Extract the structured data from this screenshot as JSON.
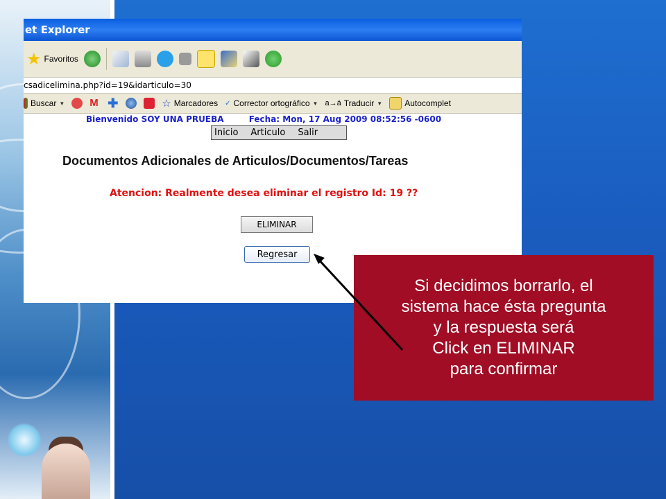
{
  "browser": {
    "title": "et Explorer",
    "toolbar": {
      "favorites_label": "Favoritos"
    },
    "address": "csadicelimina.php?id=19&idarticulo=30",
    "links": {
      "buscar": "Buscar",
      "marcadores": "Marcadores",
      "corrector": "Corrector ortográfico",
      "traducir": "Traducir",
      "autocompletar": "Autocomplet"
    }
  },
  "page": {
    "welcome": "Bienvenido SOY UNA PRUEBA",
    "fecha": "Fecha:   Mon, 17 Aug 2009 08:52:56 -0600",
    "menu": [
      "Inicio",
      "Articulo",
      "Salir"
    ],
    "title": "Documentos Adicionales de Articulos/Documentos/Tareas",
    "warning": "Atencion: Realmente desea eliminar el registro Id: 19 ??",
    "eliminar_label": "ELIMINAR",
    "regresar_label": "Regresar"
  },
  "callout": {
    "lines": [
      "Si decidimos borrarlo, el",
      "sistema hace ésta pregunta",
      "y la respuesta será",
      "Click en ELIMINAR",
      "para confirmar"
    ]
  },
  "colors": {
    "callout_bg": "#a00d25",
    "warning_text": "#e01010",
    "welcome_text": "#1a22c9",
    "background": "#1a5cbf"
  }
}
